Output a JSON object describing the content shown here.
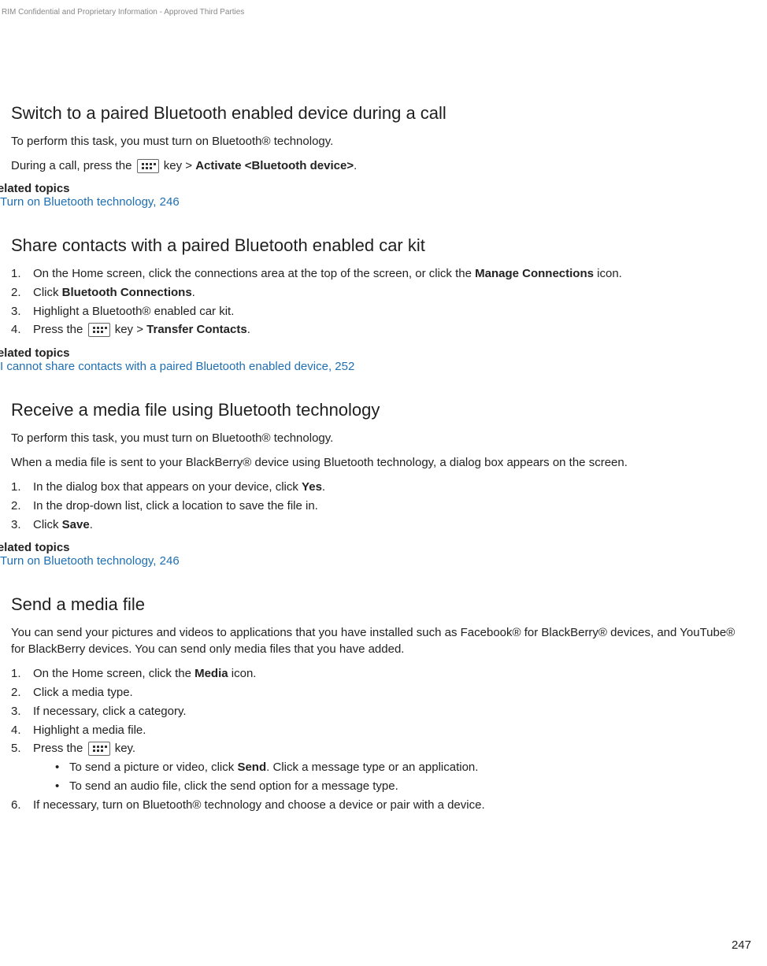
{
  "header_note": "RIM Confidential and Proprietary Information - Approved Third Parties",
  "page_number": "247",
  "sections": {
    "s1": {
      "heading": "Switch to a paired Bluetooth enabled device during a call",
      "intro": "To perform this task, you must turn on Bluetooth® technology.",
      "line_pre": "During a call, press the ",
      "line_mid": " key > ",
      "line_bold": "Activate <Bluetooth device>",
      "line_end": ".",
      "related_label": "Related topics",
      "related_link": "Turn on Bluetooth technology, 246"
    },
    "s2": {
      "heading": "Share contacts with a paired Bluetooth enabled car kit",
      "steps": {
        "a_pre": "On the Home screen, click the connections area at the top of the screen, or click the ",
        "a_bold": "Manage Connections",
        "a_post": " icon.",
        "b_pre": "Click ",
        "b_bold": "Bluetooth Connections",
        "b_post": ".",
        "c": "Highlight a Bluetooth® enabled car kit.",
        "d_pre": "Press the ",
        "d_mid": " key > ",
        "d_bold": "Transfer Contacts",
        "d_post": "."
      },
      "related_label": "Related topics",
      "related_link": "I cannot share contacts with a paired Bluetooth enabled device, 252"
    },
    "s3": {
      "heading": "Receive a media file using Bluetooth technology",
      "intro": "To perform this task, you must turn on Bluetooth® technology.",
      "intro2": "When a media file is sent to your BlackBerry® device using Bluetooth technology, a dialog box appears on the screen.",
      "steps": {
        "a_pre": "In the dialog box that appears on your device, click ",
        "a_bold": "Yes",
        "a_post": ".",
        "b": "In the drop-down list, click a location to save the file in.",
        "c_pre": "Click ",
        "c_bold": "Save",
        "c_post": "."
      },
      "related_label": "Related topics",
      "related_link": "Turn on Bluetooth technology, 246"
    },
    "s4": {
      "heading": "Send a media file",
      "intro": "You can send your pictures and videos to applications that you have installed such as Facebook® for BlackBerry® devices, and YouTube® for BlackBerry devices. You can send only media files that you have added.",
      "steps": {
        "a_pre": "On the Home screen, click the ",
        "a_bold": "Media",
        "a_post": " icon.",
        "b": "Click a media type.",
        "c": "If necessary, click a category.",
        "d": "Highlight a media file.",
        "e_pre": "Press the ",
        "e_post": " key.",
        "bullet1_pre": "To send a picture or video, click ",
        "bullet1_bold": "Send",
        "bullet1_post": ". Click a message type or an application.",
        "bullet2": "To send an audio file, click the send option for a message type.",
        "f": "If necessary, turn on Bluetooth® technology and choose a device or pair with a device."
      }
    }
  }
}
